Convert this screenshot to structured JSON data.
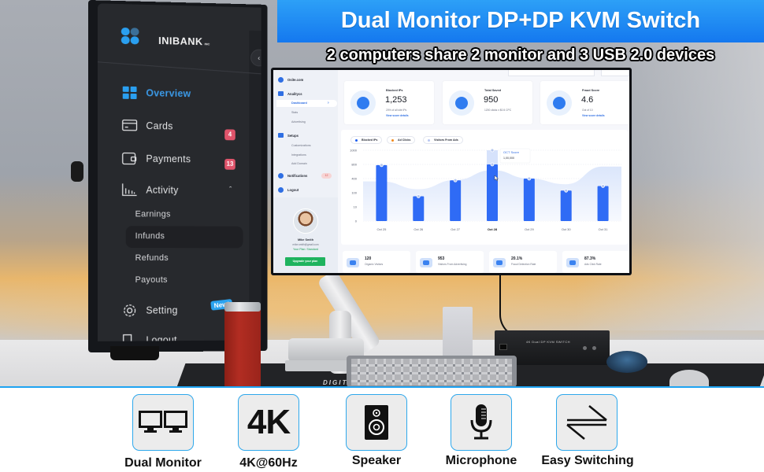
{
  "header": {
    "title": "Dual Monitor DP+DP KVM Switch",
    "subtitle": "2 computers share 2 monitor and 3 USB 2.0 devices"
  },
  "colors": {
    "banner_blue": "#1478ef",
    "accent_blue": "#2ea8ec",
    "badge_red": "#e0546b",
    "bar_blue": "#2f6bf5",
    "green": "#1fb35e"
  },
  "vertical_monitor": {
    "brand": "INIBANK",
    "brand_suffix": "INC",
    "collapse_icon": "chevron-left-icon",
    "nav": [
      {
        "label": "Overview",
        "icon": "grid-icon",
        "active": true
      },
      {
        "label": "Cards",
        "icon": "card-icon",
        "badge": "4"
      },
      {
        "label": "Payments",
        "icon": "wallet-icon",
        "badge": "13"
      },
      {
        "label": "Activity",
        "icon": "bar-chart-icon",
        "expanded": true,
        "children": [
          "Earnings",
          "Infunds",
          "Refunds",
          "Payouts"
        ],
        "active_child": "Infunds"
      },
      {
        "label": "Setting",
        "icon": "gear-icon",
        "badge": "New!"
      },
      {
        "label": "Logout",
        "icon": "logout-icon"
      }
    ]
  },
  "dashboard": {
    "sidebar": {
      "site": "Osite.com",
      "sections": [
        {
          "label": "Analitycs",
          "items": [
            "Dashboard",
            "Stats",
            "Advertising"
          ],
          "active": "Dashboard"
        },
        {
          "label": "Setups",
          "items": [
            "Customizations",
            "Integrations",
            "Add Domain"
          ]
        },
        {
          "label": "Notifications",
          "badge": "12"
        },
        {
          "label": "Logout"
        }
      ],
      "user": {
        "name": "Mike Smith",
        "email": "mike.smith@gmail.com",
        "plan": "Your Plan: Standard",
        "upgrade": "Upgrade your plan"
      }
    },
    "kpis": [
      {
        "title": "Blocked IPs",
        "value": "1,253",
        "sub": "20% of all site IPs",
        "link": "View score details",
        "icon": "blocked-ip-icon"
      },
      {
        "title": "Total Saved",
        "value": "950",
        "sub": "1200 clicks x $0.5 CPC",
        "link": "",
        "icon": "piggy-bank-icon"
      },
      {
        "title": "Fraud Score",
        "value": "4.6",
        "sub": "Out of 10",
        "link": "View score details",
        "icon": "shield-gauge-icon"
      }
    ],
    "stats": [
      {
        "value": "120",
        "label": "Organic Visitors"
      },
      {
        "value": "953",
        "label": "Visitors From Advertising"
      },
      {
        "value": "20.1%",
        "label": "Fraud Detection Rate"
      },
      {
        "value": "87.3%",
        "label": "Ads Click Rate"
      }
    ],
    "tooltip": {
      "title": "OCT Score",
      "value": "1,00,000"
    }
  },
  "chart_data": {
    "type": "bar",
    "title": "",
    "legend": [
      {
        "name": "Blocked IPs",
        "color": "#1d5ef0"
      },
      {
        "name": "Ad Clicks",
        "color": "#f28a1c"
      },
      {
        "name": "Visitors From Ads",
        "color": "#b8c6f2"
      }
    ],
    "legend_position": "top-left",
    "categories": [
      "Oct 25",
      "Oct 26",
      "Oct 27",
      "Oct 28",
      "Oct 29",
      "Oct 30",
      "Oct 31"
    ],
    "highlight_category": "Oct 28",
    "y_ticks": [
      "0",
      "10",
      "100",
      "400",
      "800",
      "1000"
    ],
    "series": [
      {
        "name": "Blocked IPs",
        "values": [
          790,
          350,
          575,
          800,
          600,
          430,
          495
        ]
      },
      {
        "name": "Visitors From Ads (area)",
        "values": [
          560,
          450,
          580,
          720,
          600,
          520,
          770
        ]
      }
    ],
    "highlight_ghost_value": 1000,
    "grid": true,
    "xlabel": "",
    "ylabel": ""
  },
  "features": [
    {
      "label": "Dual Monitor",
      "icon": "dual-monitor-icon"
    },
    {
      "label": "4K@60Hz",
      "icon": "4k-icon",
      "glyph": "4K"
    },
    {
      "label": "Speaker",
      "icon": "speaker-icon"
    },
    {
      "label": "Microphone",
      "icon": "microphone-icon"
    },
    {
      "label": "Easy Switching",
      "icon": "switch-arrows-icon"
    }
  ],
  "scene": {
    "deskmat_text": "DIGITAL AN",
    "kvm_label": "4K Dual DP KVM SWITCH"
  }
}
